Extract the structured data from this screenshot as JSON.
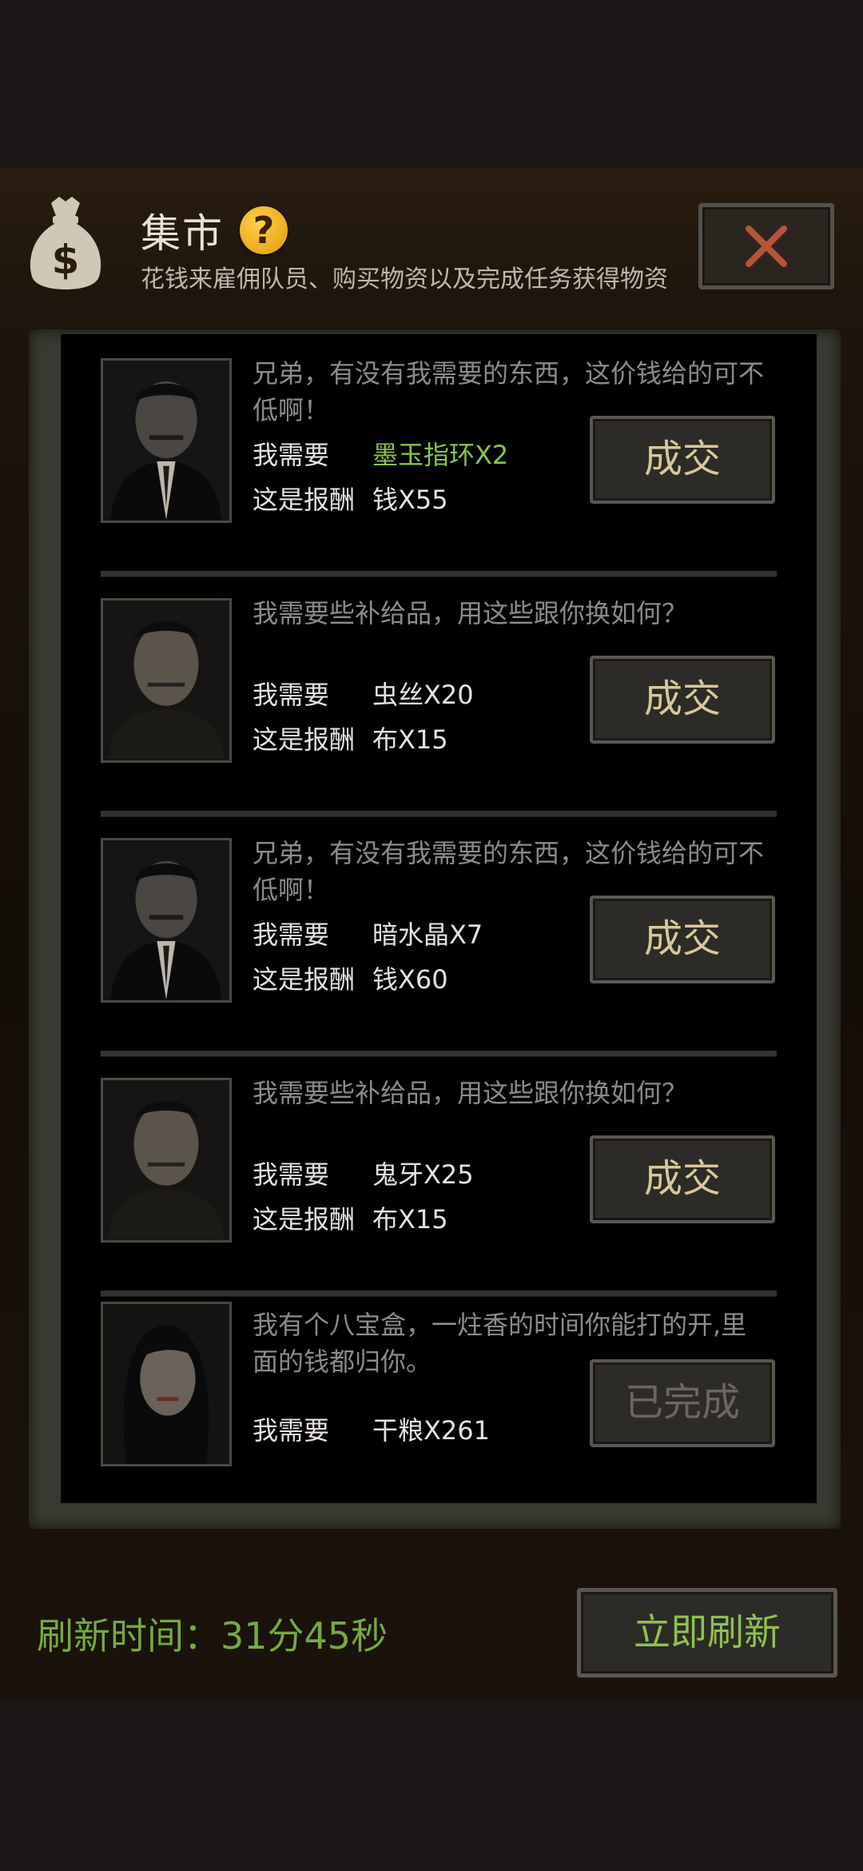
{
  "header": {
    "title": "集市",
    "subtitle": "花钱来雇佣队员、购买物资以及完成任务获得物资",
    "bag_icon": "money-bag-icon",
    "help_icon": "question-icon",
    "help_glyph": "?",
    "close_icon": "close-icon"
  },
  "colors": {
    "accent_green": "#75aa41",
    "highlight_green": "#8cc24b",
    "deal_text": "#d9c79c"
  },
  "trades": [
    {
      "message": "兄弟，有没有我需要的东西，这价钱给的可不低啊！",
      "need_label": "我需要",
      "need_item": "墨玉指环X2",
      "need_item_highlight": true,
      "reward_label": "这是报酬",
      "reward_item": "钱X55",
      "button": "成交",
      "portrait": "man-suit-portrait"
    },
    {
      "message": "我需要些补给品，用这些跟你换如何？",
      "need_label": "我需要",
      "need_item": "虫丝X20",
      "need_item_highlight": false,
      "reward_label": "这是报酬",
      "reward_item": "布X15",
      "button": "成交",
      "portrait": "man-rough-portrait"
    },
    {
      "message": "兄弟，有没有我需要的东西，这价钱给的可不低啊！",
      "need_label": "我需要",
      "need_item": "暗水晶X7",
      "need_item_highlight": false,
      "reward_label": "这是报酬",
      "reward_item": "钱X60",
      "button": "成交",
      "portrait": "man-suit-portrait"
    },
    {
      "message": "我需要些补给品，用这些跟你换如何？",
      "need_label": "我需要",
      "need_item": "鬼牙X25",
      "need_item_highlight": false,
      "reward_label": "这是报酬",
      "reward_item": "布X15",
      "button": "成交",
      "portrait": "man-rough-portrait"
    },
    {
      "message": "我有个八宝盒，一炷香的时间你能打的开,里面的钱都归你。",
      "need_label": "我需要",
      "need_item": "干粮X261",
      "need_item_highlight": false,
      "reward_label": "",
      "reward_item": "",
      "button": "已完成",
      "completed": true,
      "portrait": "woman-portrait"
    }
  ],
  "footer": {
    "refresh_time": "刷新时间：31分45秒",
    "refresh_button": "立即刷新"
  }
}
